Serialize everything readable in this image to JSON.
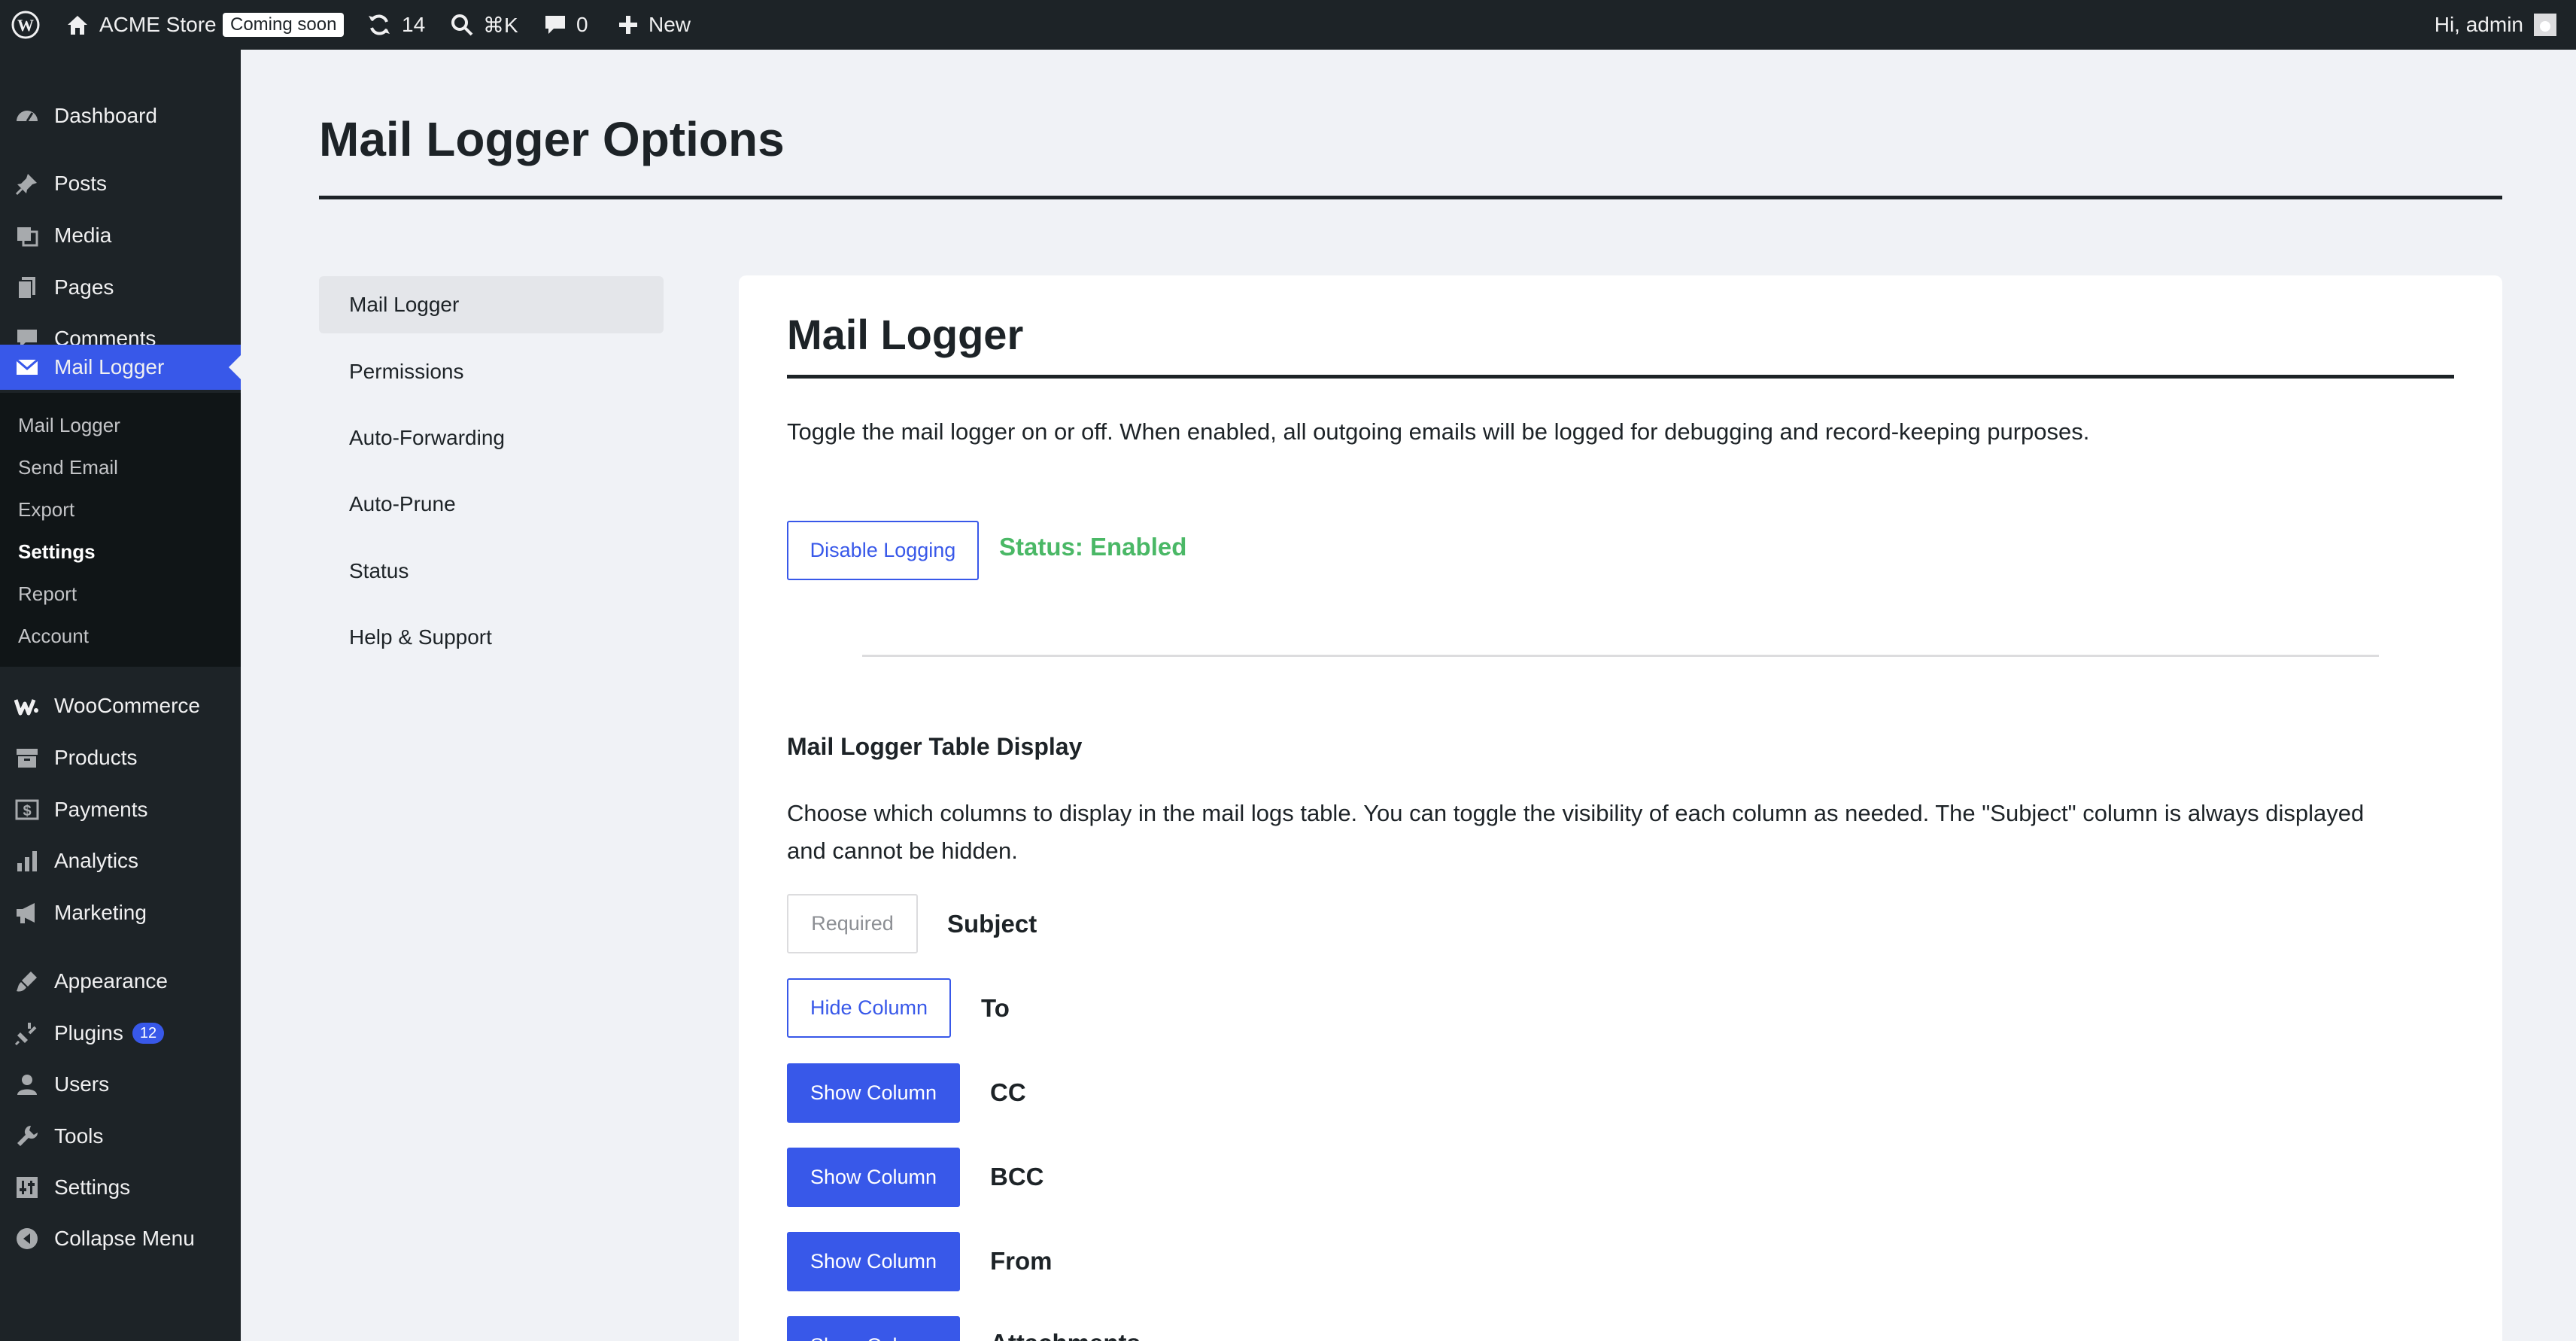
{
  "adminbar": {
    "site_name": "ACME Store",
    "coming_soon": "Coming soon",
    "updates_count": "14",
    "search_shortcut": "⌘K",
    "comments_count": "0",
    "new_label": "New",
    "greeting": "Hi, admin"
  },
  "menu": {
    "items": [
      {
        "label": "Dashboard",
        "icon": "dashboard-icon"
      },
      {
        "label": "Posts",
        "icon": "pin-icon"
      },
      {
        "label": "Media",
        "icon": "media-icon"
      },
      {
        "label": "Pages",
        "icon": "pages-icon"
      },
      {
        "label": "Comments",
        "icon": "comment-icon"
      },
      {
        "label": "Mail Logger",
        "icon": "envelope-icon"
      },
      {
        "label": "WooCommerce",
        "icon": "woo-icon"
      },
      {
        "label": "Products",
        "icon": "archive-icon"
      },
      {
        "label": "Payments",
        "icon": "dollar-icon"
      },
      {
        "label": "Analytics",
        "icon": "bar-chart-icon"
      },
      {
        "label": "Marketing",
        "icon": "megaphone-icon"
      },
      {
        "label": "Appearance",
        "icon": "brush-icon"
      },
      {
        "label": "Plugins",
        "icon": "plug-icon",
        "badge": "12"
      },
      {
        "label": "Users",
        "icon": "user-icon"
      },
      {
        "label": "Tools",
        "icon": "wrench-icon"
      },
      {
        "label": "Settings",
        "icon": "sliders-icon"
      },
      {
        "label": "Collapse Menu",
        "icon": "collapse-icon"
      }
    ],
    "submenu": [
      "Mail Logger",
      "Send Email",
      "Export",
      "Settings",
      "Report",
      "Account"
    ]
  },
  "page": {
    "title": "Mail Logger Options"
  },
  "settings_nav": [
    "Mail Logger",
    "Permissions",
    "Auto-Forwarding",
    "Auto-Prune",
    "Status",
    "Help & Support"
  ],
  "card": {
    "title": "Mail Logger",
    "description": "Toggle the mail logger on or off. When enabled, all outgoing emails will be logged for debugging and record-keeping purposes.",
    "toggle_button": "Disable Logging",
    "status": "Status: Enabled",
    "table_section_title": "Mail Logger Table Display",
    "table_section_desc_1": "Choose which columns to display in the mail logs table. You can toggle the visibility of each column as needed. The \"Subject\" column is always displayed",
    "table_section_desc_2": "and cannot be hidden.",
    "columns": [
      {
        "button": "Required",
        "label": "Subject"
      },
      {
        "button": "Hide Column",
        "label": "To"
      },
      {
        "button": "Show Column",
        "label": "CC"
      },
      {
        "button": "Show Column",
        "label": "BCC"
      },
      {
        "button": "Show Column",
        "label": "From"
      },
      {
        "button": "Show Column",
        "label": "Attachments"
      }
    ]
  },
  "colors": {
    "accent": "#3858e9",
    "status_green": "#4ab866",
    "admin_dark": "#1d2327"
  }
}
